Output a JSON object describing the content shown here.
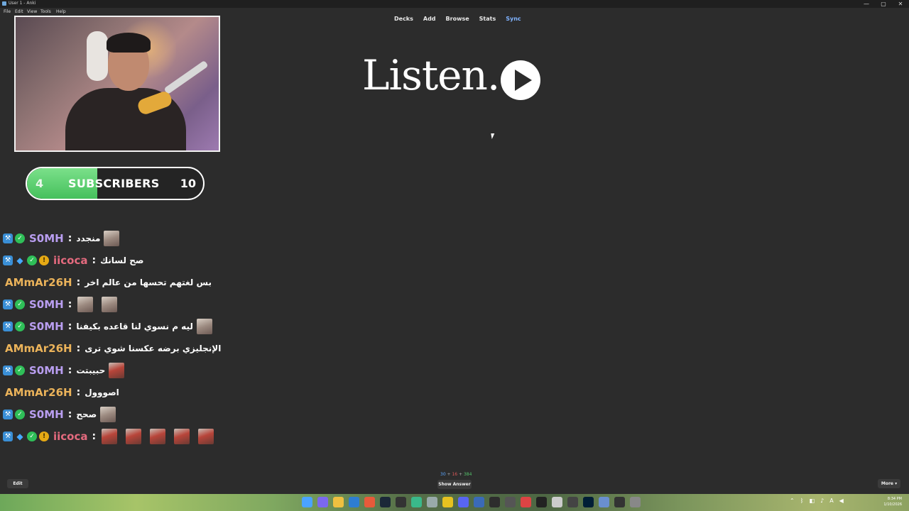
{
  "window": {
    "title": "User 1 - Anki",
    "controls": [
      "—",
      "▢",
      "✕"
    ]
  },
  "menubar": [
    "File",
    "Edit",
    "View",
    "Tools",
    "Help"
  ],
  "topnav": [
    "Decks",
    "Add",
    "Browse",
    "Stats",
    "Sync"
  ],
  "subscribers": {
    "current": "4",
    "label": "SUBSCRIBERS",
    "goal": "10",
    "progress_fraction": 0.4
  },
  "chat": [
    {
      "badges": [
        "tools",
        "verified"
      ],
      "user": "S0MH",
      "color": "purple",
      "text": "منجدد",
      "emotes": 1
    },
    {
      "badges": [
        "tools",
        "gem",
        "verified",
        "coin"
      ],
      "user": "iicoca",
      "color": "red",
      "text": "صح لسانك",
      "emotes": 0
    },
    {
      "badges": [],
      "user": "AMmAr26H",
      "color": "orange",
      "text": "بس لغتهم تحسها من عالم اخر",
      "emotes": 0
    },
    {
      "badges": [
        "tools",
        "verified"
      ],
      "user": "S0MH",
      "color": "purple",
      "text": "",
      "emotes": 2
    },
    {
      "badges": [
        "tools",
        "verified"
      ],
      "user": "S0MH",
      "color": "purple",
      "text": "ليه م نسوي لنا قاعده بكيفنا",
      "emotes": 1
    },
    {
      "badges": [],
      "user": "AMmAr26H",
      "color": "orange",
      "text": "الإنجليزي برضه عكسنا شوي ترى",
      "emotes": 0
    },
    {
      "badges": [
        "tools",
        "verified"
      ],
      "user": "S0MH",
      "color": "purple",
      "text": "حبيبتت",
      "emotes": 1
    },
    {
      "badges": [],
      "user": "AMmAr26H",
      "color": "orange",
      "text": "اصووول",
      "emotes": 0
    },
    {
      "badges": [
        "tools",
        "verified"
      ],
      "user": "S0MH",
      "color": "purple",
      "text": "صحح",
      "emotes": 1
    },
    {
      "badges": [
        "tools",
        "gem",
        "verified",
        "coin"
      ],
      "user": "iicoca",
      "color": "red",
      "text": "",
      "emotes": 5
    }
  ],
  "card": {
    "text": "Listen."
  },
  "counts": {
    "new": "30",
    "learning": "16",
    "review": "384"
  },
  "buttons": {
    "edit": "Edit",
    "show_answer": "Show Answer",
    "more": "More ▾"
  },
  "clock": {
    "time": "8:34 PM",
    "date": "1/10/2026"
  },
  "colors": {
    "purple": "#b99ef0",
    "red": "#e46a7e",
    "orange": "#ebb35a",
    "progress": "#45c05c"
  }
}
